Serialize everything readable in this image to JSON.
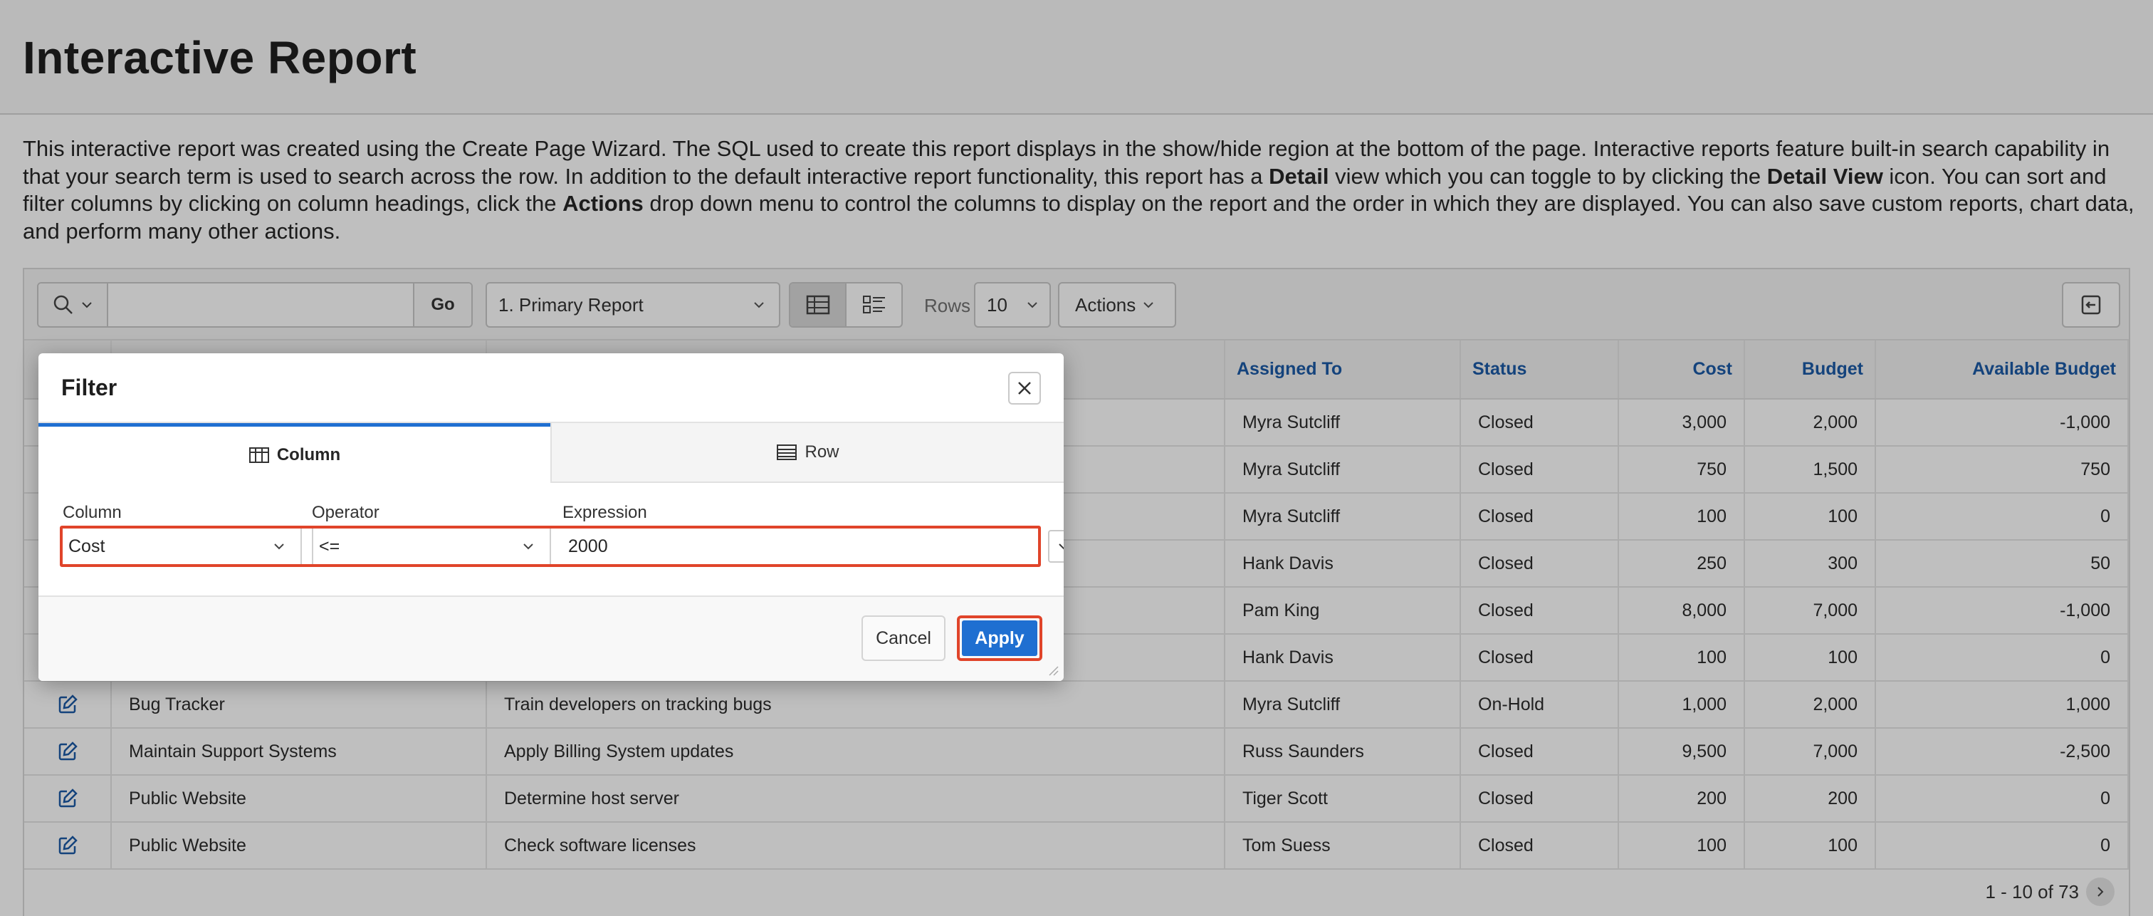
{
  "page": {
    "title": "Interactive Report",
    "description_parts": [
      {
        "t": "This interactive report was created using the Create Page Wizard. The SQL used to create this report displays in the show/hide region at the bottom of the page. Interactive reports feature built-in search capability in that your search term is used to search across the row. In addition to the default interactive report functionality, this report has a ",
        "b": false
      },
      {
        "t": "Detail",
        "b": true
      },
      {
        "t": " view which you can toggle to by clicking the ",
        "b": false
      },
      {
        "t": "Detail View",
        "b": true
      },
      {
        "t": " icon. You can sort and filter columns by clicking on column headings, click the ",
        "b": false
      },
      {
        "t": "Actions",
        "b": true
      },
      {
        "t": " drop down menu to control the columns to display on the report and the order in which they are displayed. You can also save custom reports, chart data, and perform many other actions.",
        "b": false
      }
    ]
  },
  "toolbar": {
    "search_value": "",
    "go_label": "Go",
    "report_select": "1. Primary Report",
    "rows_label": "Rows",
    "rows_value": "10",
    "actions_label": "Actions"
  },
  "table": {
    "headers": [
      "",
      "",
      "",
      "Assigned To",
      "Status",
      "Cost",
      "Budget",
      "Available Budget"
    ],
    "rows": [
      [
        "",
        "",
        "Myra Sutcliff",
        "Closed",
        "3,000",
        "2,000",
        "-1,000"
      ],
      [
        "",
        "",
        "Myra Sutcliff",
        "Closed",
        "750",
        "1,500",
        "750"
      ],
      [
        "",
        "",
        "Myra Sutcliff",
        "Closed",
        "100",
        "100",
        "0"
      ],
      [
        "",
        "",
        "Hank Davis",
        "Closed",
        "250",
        "300",
        "50"
      ],
      [
        "",
        "",
        "Pam King",
        "Closed",
        "8,000",
        "7,000",
        "-1,000"
      ],
      [
        "",
        "",
        "Hank Davis",
        "Closed",
        "100",
        "100",
        "0"
      ],
      [
        "Bug Tracker",
        "Train developers on tracking bugs",
        "Myra Sutcliff",
        "On-Hold",
        "1,000",
        "2,000",
        "1,000"
      ],
      [
        "Maintain Support Systems",
        "Apply Billing System updates",
        "Russ Saunders",
        "Closed",
        "9,500",
        "7,000",
        "-2,500"
      ],
      [
        "Public Website",
        "Determine host server",
        "Tiger Scott",
        "Closed",
        "200",
        "200",
        "0"
      ],
      [
        "Public Website",
        "Check software licenses",
        "Tom Suess",
        "Closed",
        "100",
        "100",
        "0"
      ]
    ],
    "pagination": "1 - 10 of 73"
  },
  "dialog": {
    "title": "Filter",
    "tab_column": "Column",
    "tab_row": "Row",
    "column_label": "Column",
    "column_value": "Cost",
    "operator_label": "Operator",
    "operator_value": "<=",
    "expression_label": "Expression",
    "expression_value": "2000",
    "cancel_label": "Cancel",
    "apply_label": "Apply"
  },
  "colors": {
    "accent": "#1f6fd1",
    "header_text": "#1b5aa6",
    "highlight": "#e0442a"
  },
  "icons": [
    "search-icon",
    "chevron-down-icon",
    "grid-view-icon",
    "detail-view-icon",
    "restore-icon",
    "edit-icon",
    "close-icon",
    "column-icon",
    "row-icon",
    "next-page-icon"
  ]
}
